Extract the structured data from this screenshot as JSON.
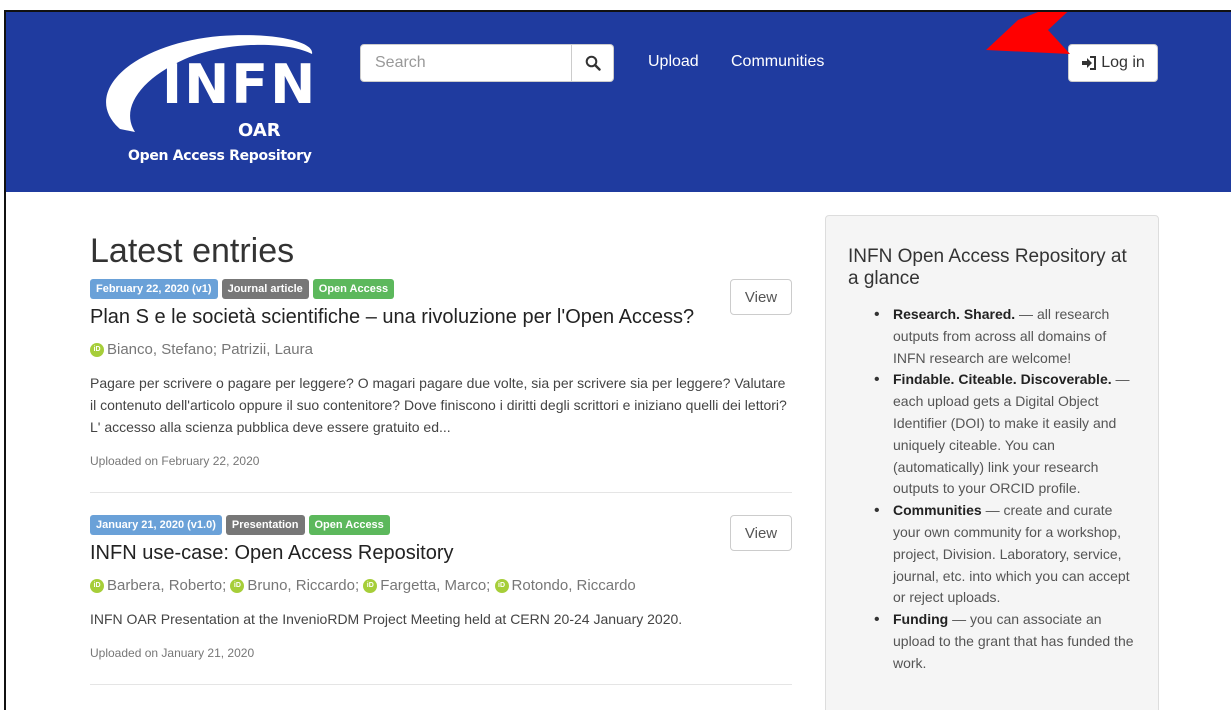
{
  "header": {
    "logo_main": "INFN",
    "logo_oar": "OAR",
    "logo_sub": "Open Access Repository",
    "search_placeholder": "Search",
    "nav": {
      "upload": "Upload",
      "communities": "Communities"
    },
    "login_label": "Log in",
    "bg_color": "#1f3b9f"
  },
  "main": {
    "heading": "Latest entries",
    "entries": [
      {
        "date_label": "February 22, 2020 (v1)",
        "type_label": "Journal article",
        "access_label": "Open Access",
        "title": "Plan S e le società scientifiche – una rivoluzione per l'Open Access?",
        "authors": [
          "Bianco, Stefano; Patrizii, Laura"
        ],
        "description": "Pagare per scrivere o pagare per leggere? O magari pagare due volte, sia per scrivere sia per leggere? Valutare il contenuto dell'articolo oppure il suo contenitore? Dove finiscono i diritti degli scrittori e iniziano quelli dei lettori? L' accesso alla scienza pubblica deve essere gratuito ed...",
        "uploaded": "Uploaded on February 22, 2020",
        "view_label": "View"
      },
      {
        "date_label": "January 21, 2020 (v1.0)",
        "type_label": "Presentation",
        "access_label": "Open Access",
        "title": "INFN use-case: Open Access Repository",
        "authors": [
          "Barbera, Roberto;",
          "Bruno, Riccardo;",
          "Fargetta, Marco;",
          "Rotondo, Riccardo"
        ],
        "description": "INFN OAR Presentation at the InvenioRDM Project Meeting held at CERN 20-24 January 2020.",
        "uploaded": "Uploaded on January 21, 2020",
        "view_label": "View"
      }
    ]
  },
  "sidebar": {
    "title": "INFN Open Access Repository at a glance",
    "items": [
      {
        "bold": "Research. Shared.",
        "text": " — all research outputs from across all domains of INFN research are welcome!"
      },
      {
        "bold": "Findable. Citeable. Discoverable.",
        "text": " — each upload gets a Digital Object Identifier (DOI) to make it easily and uniquely citeable. You can (automatically) link your research outputs to your ORCID profile."
      },
      {
        "bold": "Communities",
        "text": " — create and curate your own community for a workshop, project, Division. Laboratory, service, journal, etc. into which you can accept or reject uploads."
      },
      {
        "bold": "Funding",
        "text": " — you can associate an upload to the grant that has funded the work."
      }
    ]
  }
}
